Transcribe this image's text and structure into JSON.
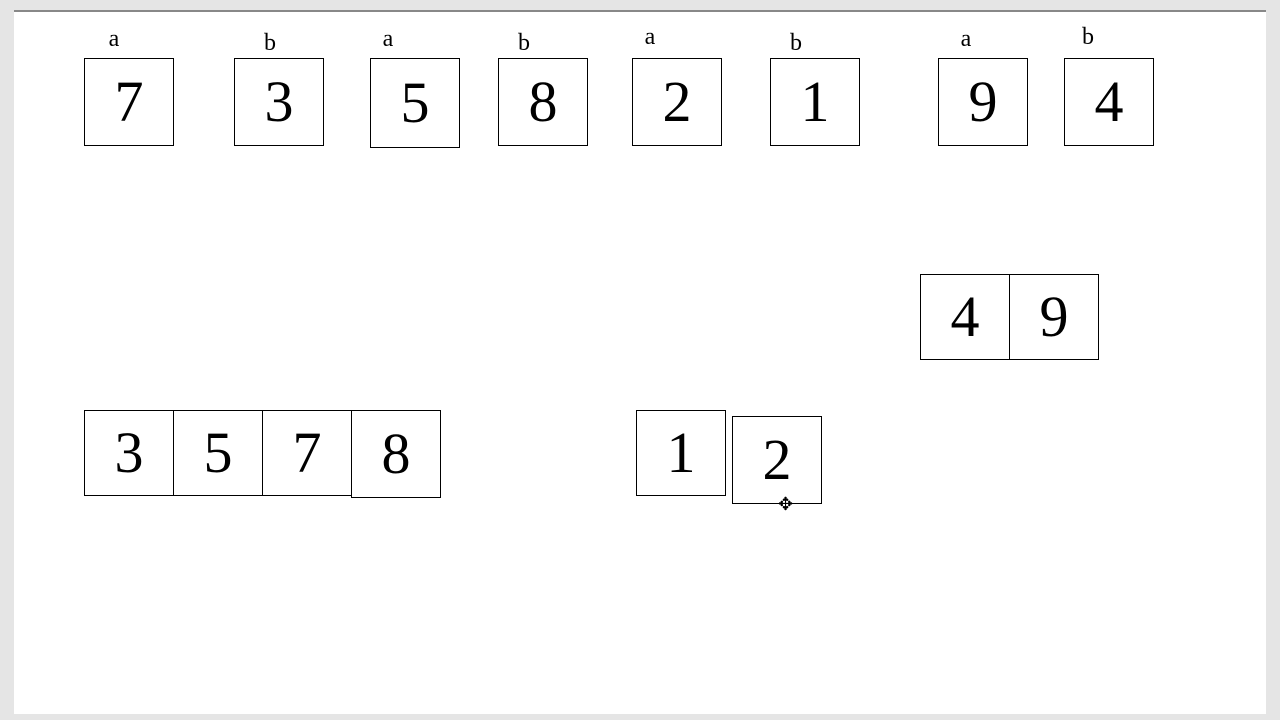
{
  "topRow": {
    "pairs": [
      {
        "a_label": "a",
        "b_label": "b",
        "a_value": "7",
        "b_value": "3"
      },
      {
        "a_label": "a",
        "b_label": "b",
        "a_value": "5",
        "b_value": "8"
      },
      {
        "a_label": "a",
        "b_label": "b",
        "a_value": "2",
        "b_value": "1"
      },
      {
        "a_label": "a",
        "b_label": "b",
        "a_value": "9",
        "b_value": "4"
      }
    ]
  },
  "rightGroup": {
    "values": [
      "4",
      "9"
    ]
  },
  "leftGroup": {
    "values": [
      "3",
      "5",
      "7",
      "8"
    ]
  },
  "midGroup": {
    "values": [
      "1",
      "2"
    ]
  },
  "cursor": "✥"
}
